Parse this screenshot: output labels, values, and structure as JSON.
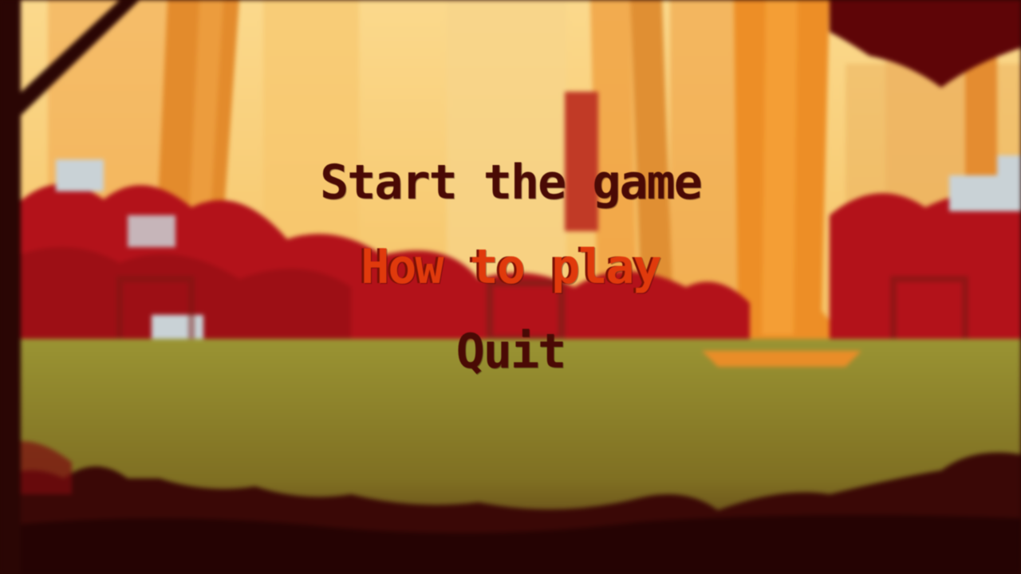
{
  "menu": {
    "items": [
      {
        "label": "Start the game",
        "selected": false
      },
      {
        "label": "How to play",
        "selected": true
      },
      {
        "label": "Quit",
        "selected": false
      }
    ]
  },
  "colors": {
    "text": "#4a0a05",
    "selected_text": "#e03a0c",
    "sky": "#f6cf74",
    "foliage": "#b3121a",
    "grass": "#8f8a2c",
    "foreground": "#2a0604"
  }
}
